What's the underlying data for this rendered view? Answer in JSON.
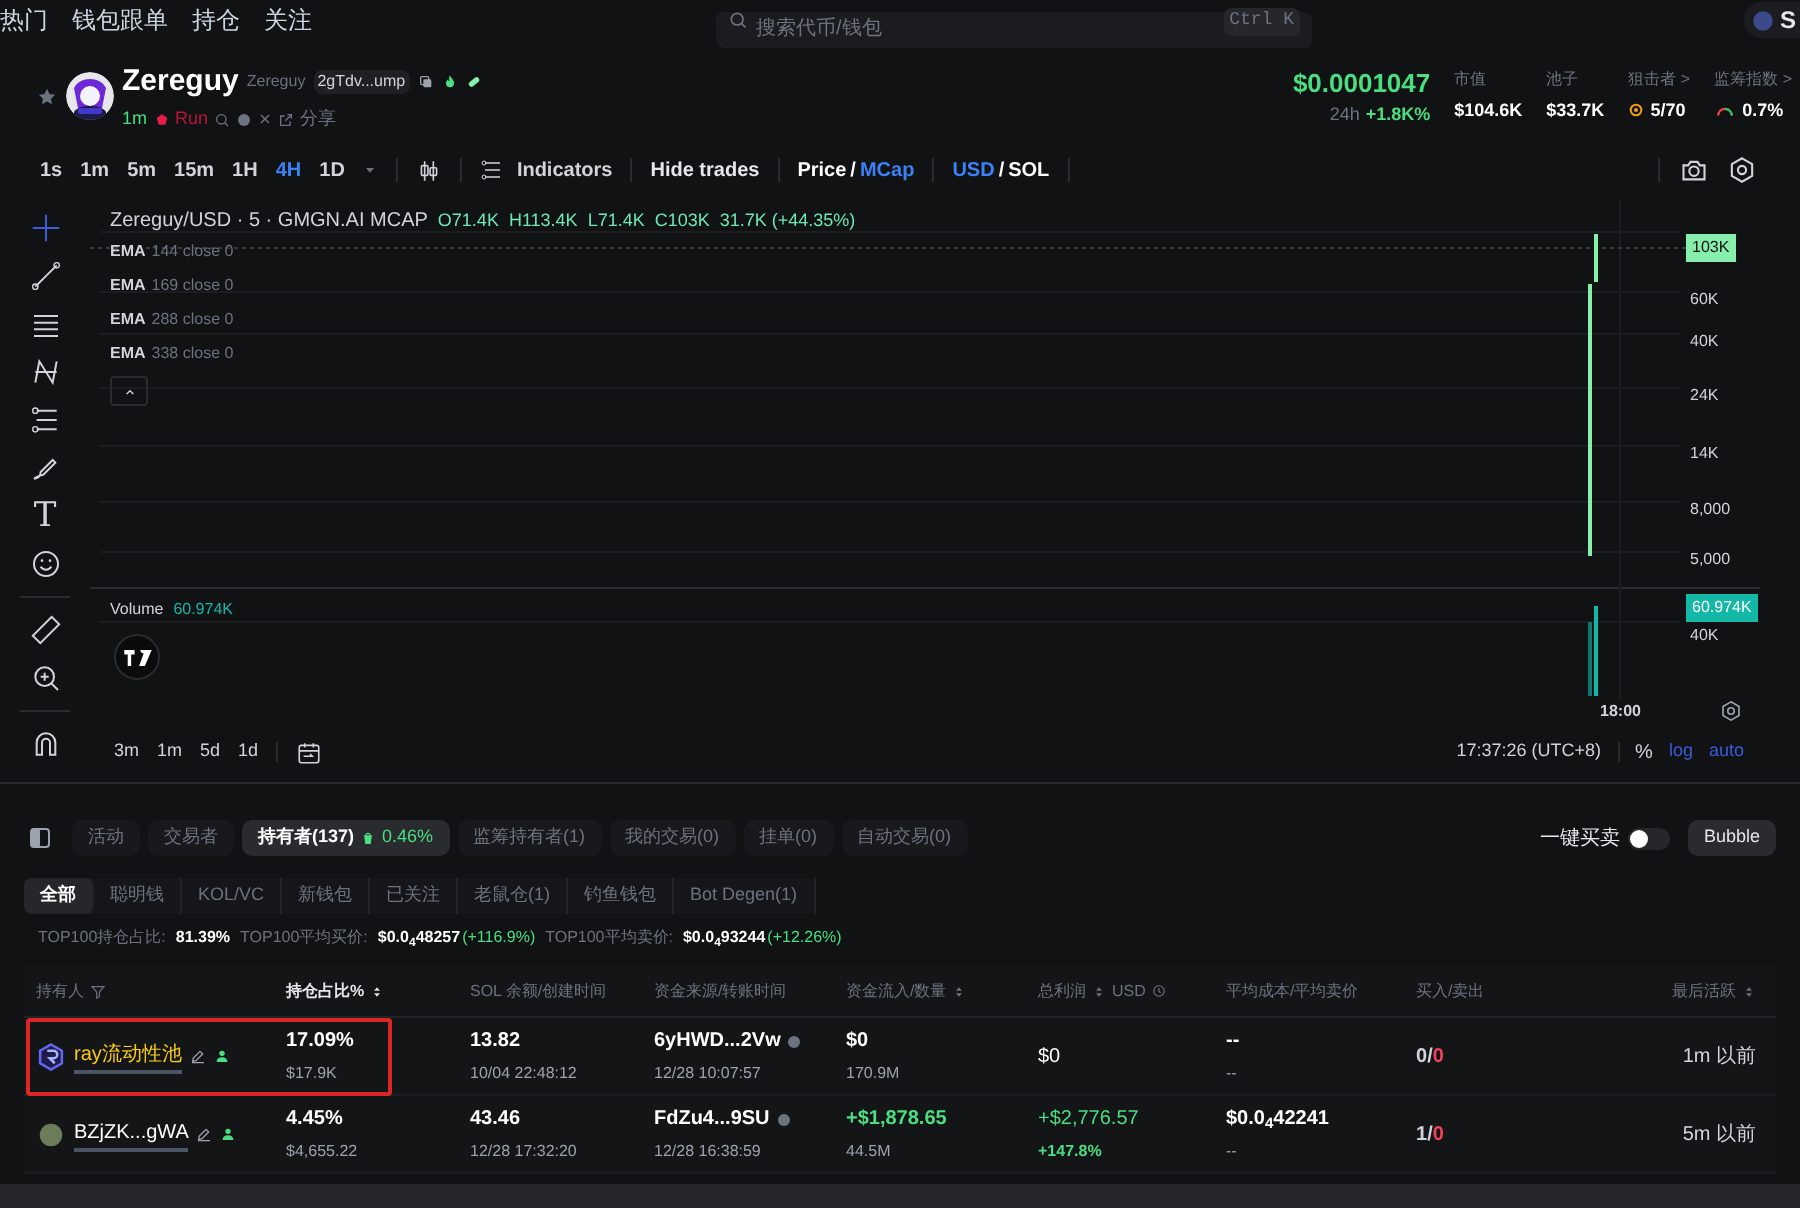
{
  "top_nav": {
    "items": [
      {
        "label": "热门"
      },
      {
        "label": "钱包跟单"
      },
      {
        "label": "持仓"
      },
      {
        "label": "关注"
      }
    ],
    "search": {
      "placeholder": "搜索代币/钱包",
      "shortcut": "Ctrl K"
    },
    "account_initial": "S"
  },
  "token": {
    "name": "Zereguy",
    "symbol": "Zereguy",
    "address": "2gTdv...ump",
    "age": "1m",
    "platform": "Run",
    "share": "分享",
    "favorite": false
  },
  "stats": {
    "price": "$0.0001047",
    "change_label": "24h",
    "change": "+1.8K%",
    "items": [
      {
        "kind": "plain",
        "label": "市值",
        "value": "$104.6K"
      },
      {
        "kind": "plain",
        "label": "池子",
        "value": "$33.7K"
      },
      {
        "kind": "target",
        "label": "狙击者 >",
        "value": "5/70"
      },
      {
        "kind": "gauge",
        "label": "监筹指数 >",
        "value": "0.7%"
      }
    ]
  },
  "toolbar": {
    "intervals": [
      {
        "label": "1s",
        "selected": false
      },
      {
        "label": "1m",
        "selected": false
      },
      {
        "label": "5m",
        "selected": false
      },
      {
        "label": "15m",
        "selected": false
      },
      {
        "label": "1H",
        "selected": false
      },
      {
        "label": "4H",
        "selected": true
      },
      {
        "label": "1D",
        "selected": false
      }
    ],
    "indicators": "Indicators",
    "hide_trades": "Hide trades",
    "value_mode": {
      "separator": "/",
      "options": [
        {
          "label": "Price",
          "selected": false
        },
        {
          "label": "MCap",
          "selected": true
        }
      ]
    },
    "currency": {
      "separator": "/",
      "options": [
        {
          "label": "USD",
          "selected": true
        },
        {
          "label": "SOL",
          "selected": false
        }
      ]
    }
  },
  "drawing_tools": [
    {
      "kind": "crosshair",
      "selected": true
    },
    {
      "kind": "line",
      "selected": false
    },
    {
      "kind": "hlines",
      "selected": false
    },
    {
      "kind": "pattern",
      "selected": false
    },
    {
      "kind": "fib",
      "selected": false
    },
    {
      "kind": "brush",
      "selected": false
    },
    {
      "kind": "text",
      "glyph": "T",
      "selected": false
    },
    {
      "kind": "emoji",
      "selected": false
    },
    {
      "kind": "ruler",
      "selected": false
    },
    {
      "kind": "zoom",
      "selected": false
    },
    {
      "kind": "magnet",
      "selected": false
    }
  ],
  "chart": {
    "title": "Zereguy/USD · 5 · GMGN.AI MCAP",
    "ohlc": [
      "O71.4K",
      "H113.4K",
      "L71.4K",
      "C103K",
      "31.7K (+44.35%)"
    ],
    "emas": [
      {
        "name": "EMA",
        "params": "144 close 0"
      },
      {
        "name": "EMA",
        "params": "169 close 0"
      },
      {
        "name": "EMA",
        "params": "288 close 0"
      },
      {
        "name": "EMA",
        "params": "338 close 0"
      }
    ],
    "price_axis": [
      "60K",
      "40K",
      "24K",
      "14K",
      "8,000",
      "5,000"
    ],
    "current_value": "103K",
    "volume": {
      "label": "Volume",
      "value": "60.974K",
      "axis": [
        "40K"
      ],
      "badge": "60.974K"
    },
    "time_axis": [
      "18:00"
    ],
    "ranges": [
      "3m",
      "1m",
      "5d",
      "1d"
    ],
    "clock": "17:37:26 (UTC+8)",
    "percent": "%",
    "log": "log",
    "auto": "auto"
  },
  "tabs": [
    {
      "label": "活动",
      "selected": false
    },
    {
      "label": "交易者",
      "selected": false
    },
    {
      "label": "持有者(137)",
      "badge": "0.46%",
      "selected": true
    },
    {
      "label": "监筹持有者(1)",
      "selected": false
    },
    {
      "label": "我的交易(0)",
      "selected": false
    },
    {
      "label": "挂单(0)",
      "selected": false
    },
    {
      "label": "自动交易(0)",
      "selected": false
    }
  ],
  "quick_trade": {
    "label": "一键买卖",
    "on": false
  },
  "bubble": "Bubble",
  "filters": [
    {
      "label": "全部",
      "selected": true
    },
    {
      "label": "聪明钱",
      "selected": false
    },
    {
      "label": "KOL/VC",
      "selected": false
    },
    {
      "label": "新钱包",
      "selected": false
    },
    {
      "label": "已关注",
      "selected": false
    },
    {
      "label": "老鼠仓(1)",
      "selected": false
    },
    {
      "label": "钓鱼钱包",
      "selected": false
    },
    {
      "label": "Bot Degen(1)",
      "selected": false
    }
  ],
  "summary": [
    {
      "label": "TOP100持仓占比:",
      "value": "81.39%"
    },
    {
      "label": "TOP100平均买价:",
      "value": "$0.0$_{4}$48257",
      "change": "(+116.9%)"
    },
    {
      "label": "TOP100平均卖价:",
      "value": "$0.0$_{4}$93244",
      "change": "(+12.26%)"
    }
  ],
  "table": {
    "columns": [
      {
        "label": "持有人",
        "filter": true,
        "sort": false
      },
      {
        "label": "持仓占比%",
        "sort": true
      },
      {
        "label": "SOL 余额/创建时间",
        "sort": false
      },
      {
        "label": "资金来源/转账时间",
        "sort": false
      },
      {
        "label": "资金流入/数量",
        "sort": true
      },
      {
        "label": "总利润",
        "sort": true,
        "suffix": "USD"
      },
      {
        "label": "平均成本/平均卖价",
        "sort": false
      },
      {
        "label": "买入/卖出",
        "sort": false
      },
      {
        "label": "最后活跃",
        "sort": true
      }
    ],
    "rows": [
      {
        "highlighted": true,
        "holder": {
          "name": "ray流动性池",
          "kind": "pool"
        },
        "share": "17.09%",
        "share_value": "$17.9K",
        "sol": "13.82",
        "created": "10/04 22:48:12",
        "source": "6yHWD...2Vw",
        "source_time": "12/28 10:07:57",
        "inflow": "$0",
        "inflow_positive": false,
        "amount": "170.9M",
        "profit": "$0",
        "profit_positive": false,
        "avg_cost": "--",
        "avg_sell": "--",
        "buys": "0",
        "separator": "/",
        "sells": "0",
        "last_active": "1m 以前"
      },
      {
        "highlighted": false,
        "holder": {
          "name": "BZjZK...gWA",
          "kind": "wallet"
        },
        "share": "4.45%",
        "share_value": "$4,655.22",
        "sol": "43.46",
        "created": "12/28 17:32:20",
        "source": "FdZu4...9SU",
        "source_time": "12/28 16:38:59",
        "inflow": "+$1,878.65",
        "inflow_positive": true,
        "amount": "44.5M",
        "profit": "+$2,776.57",
        "profit_positive": true,
        "profit_pct": "+147.8%",
        "avg_cost": "$0.0$_{4}$42241",
        "avg_sell": "--",
        "buys": "1",
        "separator": "/",
        "sells": "0",
        "last_active": "5m 以前"
      }
    ]
  }
}
